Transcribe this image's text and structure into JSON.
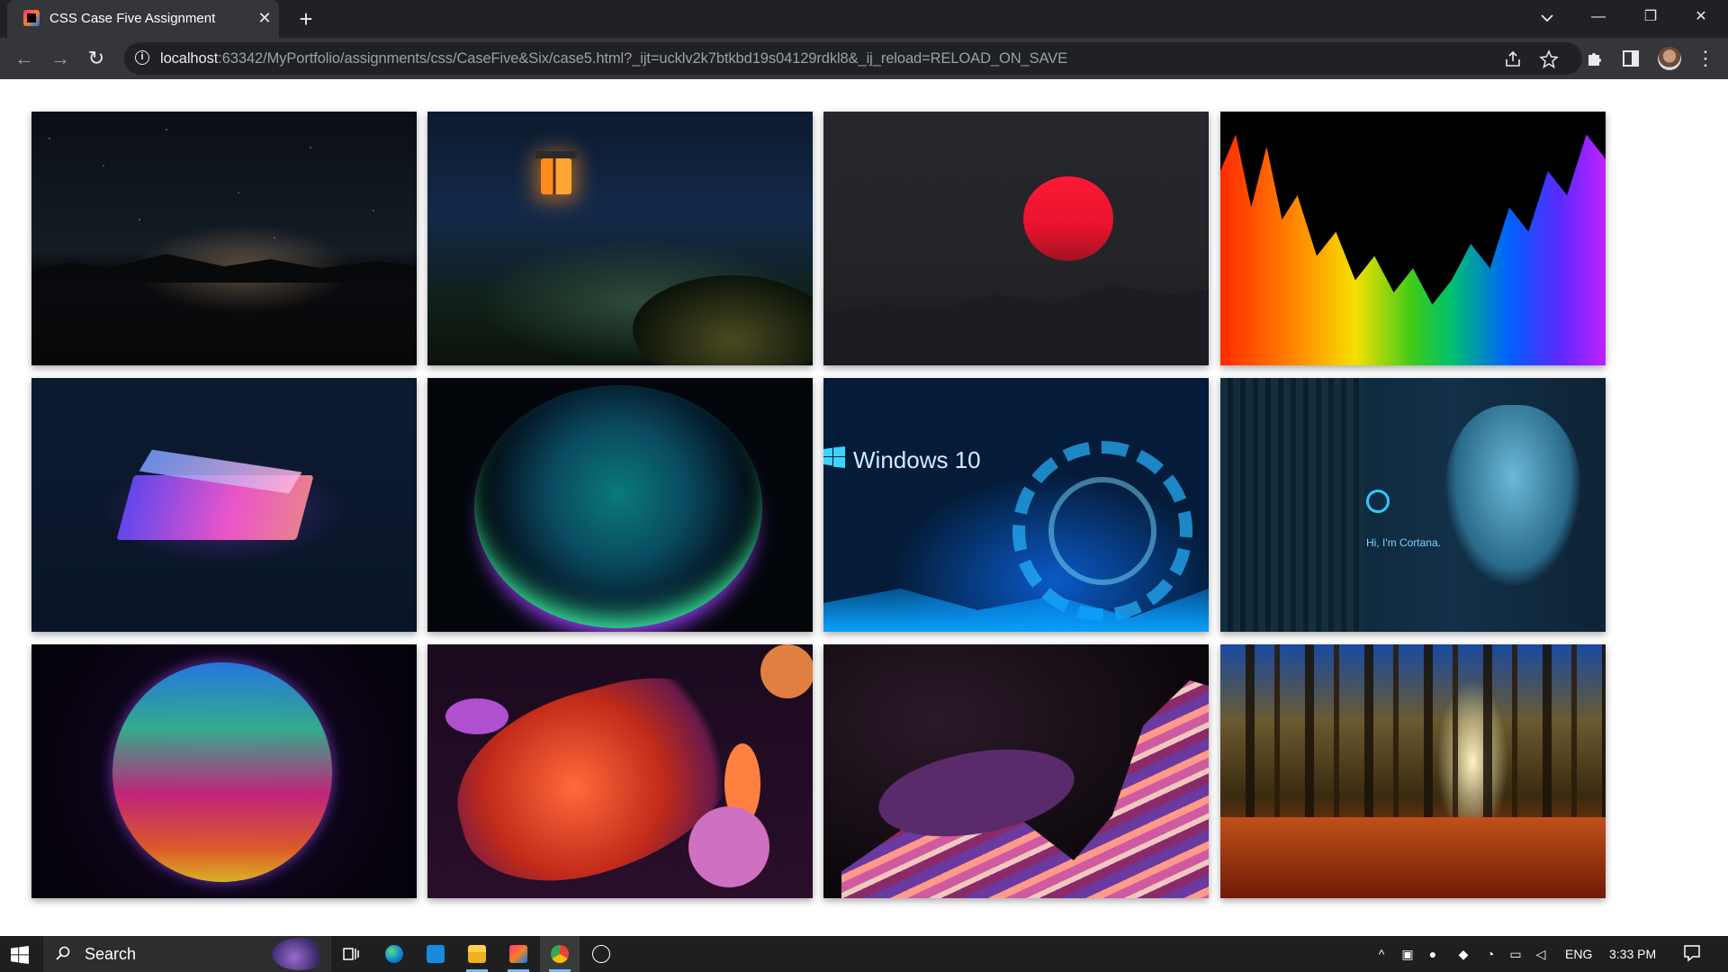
{
  "browser": {
    "tab": {
      "title": "CSS Case Five Assignment",
      "close": "✕"
    },
    "new_tab": "+",
    "window_controls": {
      "minimize": "—",
      "restore": "❐",
      "close": "✕"
    },
    "nav": {
      "back": "←",
      "forward": "→",
      "reload": "↻"
    },
    "address": {
      "host": "localhost",
      "rest": ":63342/MyPortfolio/assignments/css/CaseFive&Six/case5.html?_ijt=ucklv2k7btkbd19s04129rdkl8&_ij_reload=RELOAD_ON_SAVE"
    },
    "menu": "⋮"
  },
  "gallery": {
    "images": [
      {
        "name": "night-sky-lake-image"
      },
      {
        "name": "forest-lantern-image"
      },
      {
        "name": "red-sun-image"
      },
      {
        "name": "rainbow-equalizer-image"
      },
      {
        "name": "neon-laptop-image"
      },
      {
        "name": "glowing-bubble-image"
      },
      {
        "name": "windows-10-image",
        "text": "Windows 10"
      },
      {
        "name": "cortana-image",
        "text": "Hi, I'm Cortana."
      },
      {
        "name": "rainbow-orb-image"
      },
      {
        "name": "abstract-fluid-image"
      },
      {
        "name": "windows-11-ribbon-image"
      },
      {
        "name": "autumn-forest-image"
      }
    ]
  },
  "taskbar": {
    "search_text": "Search",
    "language": "ENG",
    "time": "3:33 PM",
    "chevron": "^",
    "apps": [
      "task-view",
      "edge",
      "mail",
      "file-explorer",
      "intellij",
      "chrome",
      "clock"
    ]
  },
  "colors": {
    "tabstrip": "#202124",
    "toolbar": "#35363a",
    "omnibox": "#202124",
    "taskbar": "#1f1f1f",
    "accent": "#76b9ed"
  }
}
